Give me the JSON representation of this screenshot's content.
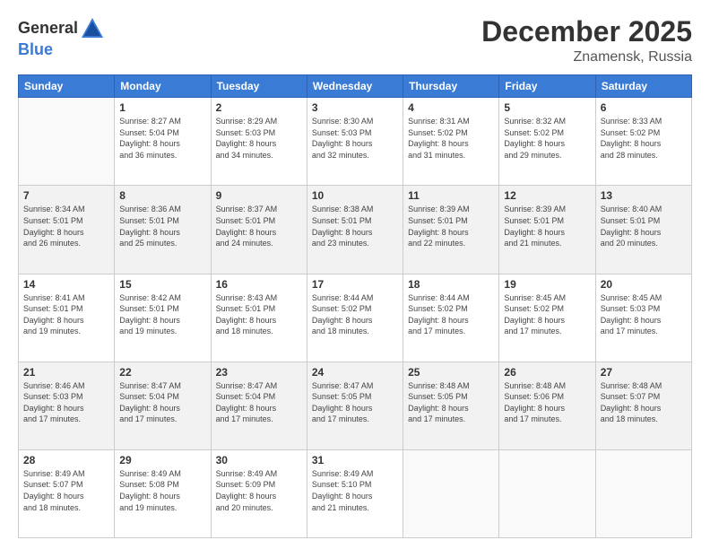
{
  "header": {
    "logo_general": "General",
    "logo_blue": "Blue",
    "title": "December 2025",
    "subtitle": "Znamensk, Russia"
  },
  "weekdays": [
    "Sunday",
    "Monday",
    "Tuesday",
    "Wednesday",
    "Thursday",
    "Friday",
    "Saturday"
  ],
  "weeks": [
    [
      {
        "day": "",
        "info": ""
      },
      {
        "day": "1",
        "info": "Sunrise: 8:27 AM\nSunset: 5:04 PM\nDaylight: 8 hours\nand 36 minutes."
      },
      {
        "day": "2",
        "info": "Sunrise: 8:29 AM\nSunset: 5:03 PM\nDaylight: 8 hours\nand 34 minutes."
      },
      {
        "day": "3",
        "info": "Sunrise: 8:30 AM\nSunset: 5:03 PM\nDaylight: 8 hours\nand 32 minutes."
      },
      {
        "day": "4",
        "info": "Sunrise: 8:31 AM\nSunset: 5:02 PM\nDaylight: 8 hours\nand 31 minutes."
      },
      {
        "day": "5",
        "info": "Sunrise: 8:32 AM\nSunset: 5:02 PM\nDaylight: 8 hours\nand 29 minutes."
      },
      {
        "day": "6",
        "info": "Sunrise: 8:33 AM\nSunset: 5:02 PM\nDaylight: 8 hours\nand 28 minutes."
      }
    ],
    [
      {
        "day": "7",
        "info": "Sunrise: 8:34 AM\nSunset: 5:01 PM\nDaylight: 8 hours\nand 26 minutes."
      },
      {
        "day": "8",
        "info": "Sunrise: 8:36 AM\nSunset: 5:01 PM\nDaylight: 8 hours\nand 25 minutes."
      },
      {
        "day": "9",
        "info": "Sunrise: 8:37 AM\nSunset: 5:01 PM\nDaylight: 8 hours\nand 24 minutes."
      },
      {
        "day": "10",
        "info": "Sunrise: 8:38 AM\nSunset: 5:01 PM\nDaylight: 8 hours\nand 23 minutes."
      },
      {
        "day": "11",
        "info": "Sunrise: 8:39 AM\nSunset: 5:01 PM\nDaylight: 8 hours\nand 22 minutes."
      },
      {
        "day": "12",
        "info": "Sunrise: 8:39 AM\nSunset: 5:01 PM\nDaylight: 8 hours\nand 21 minutes."
      },
      {
        "day": "13",
        "info": "Sunrise: 8:40 AM\nSunset: 5:01 PM\nDaylight: 8 hours\nand 20 minutes."
      }
    ],
    [
      {
        "day": "14",
        "info": "Sunrise: 8:41 AM\nSunset: 5:01 PM\nDaylight: 8 hours\nand 19 minutes."
      },
      {
        "day": "15",
        "info": "Sunrise: 8:42 AM\nSunset: 5:01 PM\nDaylight: 8 hours\nand 19 minutes."
      },
      {
        "day": "16",
        "info": "Sunrise: 8:43 AM\nSunset: 5:01 PM\nDaylight: 8 hours\nand 18 minutes."
      },
      {
        "day": "17",
        "info": "Sunrise: 8:44 AM\nSunset: 5:02 PM\nDaylight: 8 hours\nand 18 minutes."
      },
      {
        "day": "18",
        "info": "Sunrise: 8:44 AM\nSunset: 5:02 PM\nDaylight: 8 hours\nand 17 minutes."
      },
      {
        "day": "19",
        "info": "Sunrise: 8:45 AM\nSunset: 5:02 PM\nDaylight: 8 hours\nand 17 minutes."
      },
      {
        "day": "20",
        "info": "Sunrise: 8:45 AM\nSunset: 5:03 PM\nDaylight: 8 hours\nand 17 minutes."
      }
    ],
    [
      {
        "day": "21",
        "info": "Sunrise: 8:46 AM\nSunset: 5:03 PM\nDaylight: 8 hours\nand 17 minutes."
      },
      {
        "day": "22",
        "info": "Sunrise: 8:47 AM\nSunset: 5:04 PM\nDaylight: 8 hours\nand 17 minutes."
      },
      {
        "day": "23",
        "info": "Sunrise: 8:47 AM\nSunset: 5:04 PM\nDaylight: 8 hours\nand 17 minutes."
      },
      {
        "day": "24",
        "info": "Sunrise: 8:47 AM\nSunset: 5:05 PM\nDaylight: 8 hours\nand 17 minutes."
      },
      {
        "day": "25",
        "info": "Sunrise: 8:48 AM\nSunset: 5:05 PM\nDaylight: 8 hours\nand 17 minutes."
      },
      {
        "day": "26",
        "info": "Sunrise: 8:48 AM\nSunset: 5:06 PM\nDaylight: 8 hours\nand 17 minutes."
      },
      {
        "day": "27",
        "info": "Sunrise: 8:48 AM\nSunset: 5:07 PM\nDaylight: 8 hours\nand 18 minutes."
      }
    ],
    [
      {
        "day": "28",
        "info": "Sunrise: 8:49 AM\nSunset: 5:07 PM\nDaylight: 8 hours\nand 18 minutes."
      },
      {
        "day": "29",
        "info": "Sunrise: 8:49 AM\nSunset: 5:08 PM\nDaylight: 8 hours\nand 19 minutes."
      },
      {
        "day": "30",
        "info": "Sunrise: 8:49 AM\nSunset: 5:09 PM\nDaylight: 8 hours\nand 20 minutes."
      },
      {
        "day": "31",
        "info": "Sunrise: 8:49 AM\nSunset: 5:10 PM\nDaylight: 8 hours\nand 21 minutes."
      },
      {
        "day": "",
        "info": ""
      },
      {
        "day": "",
        "info": ""
      },
      {
        "day": "",
        "info": ""
      }
    ]
  ]
}
